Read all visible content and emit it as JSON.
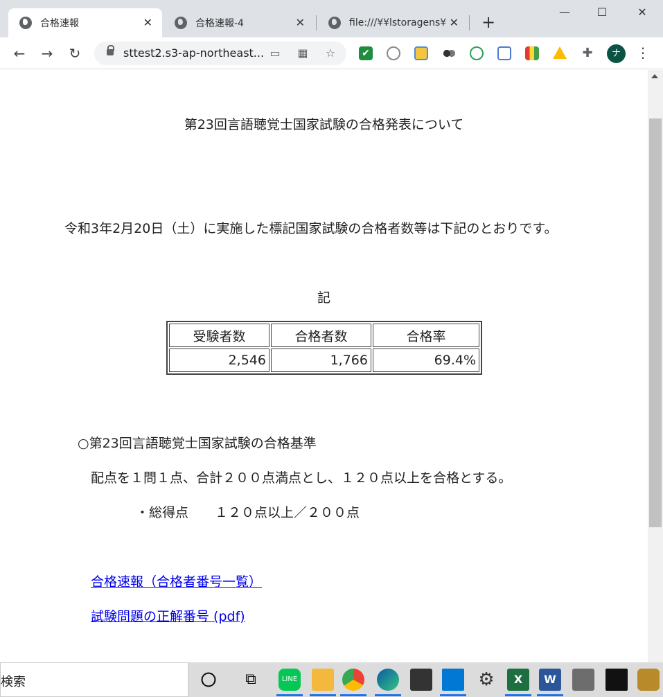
{
  "browser": {
    "tabs": [
      {
        "title": "合格速報"
      },
      {
        "title": "合格速報-4"
      },
      {
        "title": "file:///¥¥lstoragens¥ap"
      }
    ],
    "url": "sttest2.s3-ap-northeast...",
    "avatar_initial": "ナ",
    "window_controls": {
      "minimize": "—",
      "maximize": "☐",
      "close": "✕"
    }
  },
  "page": {
    "title": "第23回言語聴覚士国家試験の合格発表について",
    "intro": "令和3年2月20日（土）に実施した標記国家試験の合格者数等は下記のとおりです。",
    "ki": "記",
    "table": {
      "headers": [
        "受験者数",
        "合格者数",
        "合格率"
      ],
      "values": [
        "2,546",
        "1,766",
        "69.4%"
      ]
    },
    "criteria": {
      "heading": "○第23回言語聴覚士国家試験の合格基準",
      "description": "配点を１問１点、合計２００点満点とし、１２０点以上を合格とする。",
      "item": "・総得点　　１２０点以上／２００点"
    },
    "links": [
      {
        "label": "合格速報（合格者番号一覧）"
      },
      {
        "label": "試験問題の正解番号 (pdf)"
      }
    ]
  },
  "taskbar": {
    "search_label": "検索"
  },
  "colors": {
    "link": "#0000ee",
    "avatar_bg": "#0b5345",
    "tabstrip_bg": "#dee1e6"
  }
}
